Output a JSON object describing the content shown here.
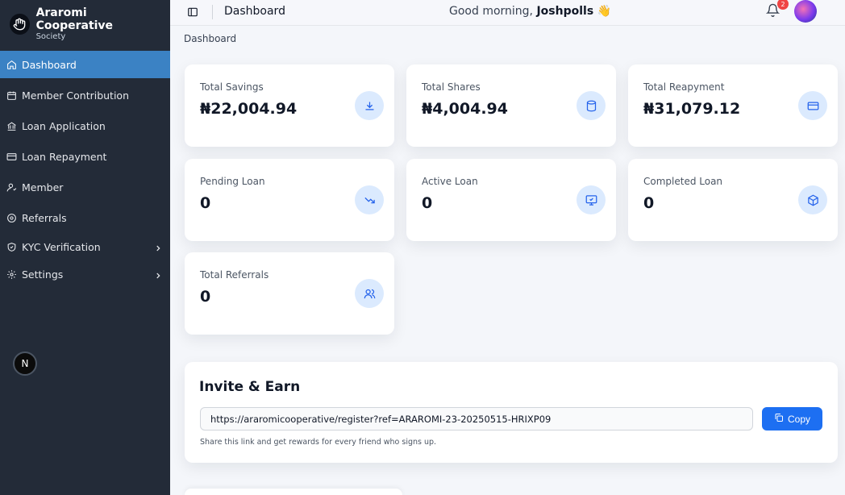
{
  "brand": {
    "name": "Araromi Cooperative",
    "sub": "Society",
    "logo_icon": "hand-icon"
  },
  "sidebar": {
    "items": [
      {
        "label": "Dashboard",
        "icon": "home-icon",
        "active": true
      },
      {
        "label": "Member Contribution",
        "icon": "calendar-icon"
      },
      {
        "label": "Loan Application",
        "icon": "bank-icon"
      },
      {
        "label": "Loan Repayment",
        "icon": "credit-card-icon"
      },
      {
        "label": "Member",
        "icon": "user-icon"
      },
      {
        "label": "Referrals",
        "icon": "at-sign-icon"
      },
      {
        "label": "KYC Verification",
        "icon": "shield-check-icon",
        "has_children": true
      },
      {
        "label": "Settings",
        "icon": "gear-icon",
        "has_children": true
      }
    ],
    "dev_badge": "N"
  },
  "topbar": {
    "title": "Dashboard",
    "greeting_prefix": "Good morning,",
    "user_name": "Joshpolls",
    "greeting_emoji": "👋",
    "notification_count": "2"
  },
  "breadcrumb": "Dashboard",
  "stats": [
    {
      "label": "Total Savings",
      "value": "₦22,004.94",
      "icon": "download-icon"
    },
    {
      "label": "Total Shares",
      "value": "₦4,004.94",
      "icon": "database-icon"
    },
    {
      "label": "Total Reapyment",
      "value": "₦31,079.12",
      "icon": "credit-card-icon"
    },
    {
      "label": "Pending Loan",
      "value": "0",
      "icon": "trending-down-icon"
    },
    {
      "label": "Active Loan",
      "value": "0",
      "icon": "monitor-check-icon"
    },
    {
      "label": "Completed Loan",
      "value": "0",
      "icon": "package-icon"
    },
    {
      "label": "Total Referrals",
      "value": "0",
      "icon": "users-icon"
    }
  ],
  "invite": {
    "title": "Invite & Earn",
    "link": "https://araromicooperative/register?ref=ARAROMI-23-20250515-HRIXP09",
    "copy_label": "Copy",
    "help": "Share this link and get rewards for every friend who signs up."
  },
  "colors": {
    "sidebar_bg": "#232b38",
    "active_bg": "#3b82c4",
    "accent": "#1d6ff2",
    "icon_bg": "#dbeafe"
  }
}
